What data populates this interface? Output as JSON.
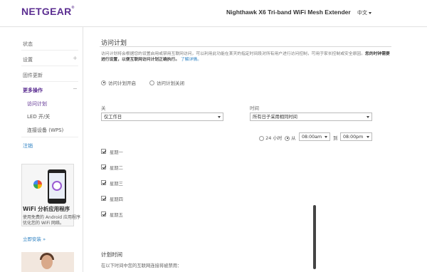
{
  "header": {
    "logo": "NETGEAR",
    "logo_mark": "®",
    "product_name": "Nighthawk X6 Tri-band WiFi Mesh Extender",
    "language": "中文"
  },
  "sidebar": {
    "items": [
      {
        "label": "状态"
      },
      {
        "label": "设置",
        "toggle": "+"
      },
      {
        "label": "固件更新"
      },
      {
        "label": "更多操作",
        "toggle": "−"
      }
    ],
    "subitems": [
      {
        "label": "访问计划",
        "selected": true
      },
      {
        "label": "LED 开/关"
      },
      {
        "label": "连接设备 (WPS)"
      }
    ],
    "logout": "注销",
    "promo": {
      "title": "WiFi 分析应用程序",
      "description": "使用免费的 Android 应用程序优化您的 WiFi 网络。",
      "link": "立即安装 »"
    }
  },
  "main": {
    "title": "访问计划",
    "intro": "访问计划将会根据您的设置启用或禁用互联网访问，可以利用此功能在某天的指定时间段对所有用户进行访问控制，可用于家长控制或安全原因。",
    "intro_bold": "您的时钟需要进行设置，以便互联网访问计划正确执行。",
    "intro_link": "了解详情。",
    "radio_on": "访问计划开启",
    "radio_off": "访问计划关闭",
    "schedule_on_selected": true,
    "off_label": "关",
    "off_select_value": "仅工作日",
    "time_label": "时间",
    "time_select_value": "所有日子采用相同时间",
    "allday_label": "24 小时",
    "from_label": "从",
    "from_value": "08:00am",
    "to_label": "到",
    "to_value": "08:00pm",
    "days": [
      {
        "label": "星期一",
        "checked": true
      },
      {
        "label": "星期二",
        "checked": true
      },
      {
        "label": "星期三",
        "checked": true
      },
      {
        "label": "星期四",
        "checked": true
      },
      {
        "label": "星期五",
        "checked": true
      }
    ],
    "schedule_section_title": "计划时间",
    "schedule_section_text": "在以下时间中您的互联网连接将被禁用："
  }
}
